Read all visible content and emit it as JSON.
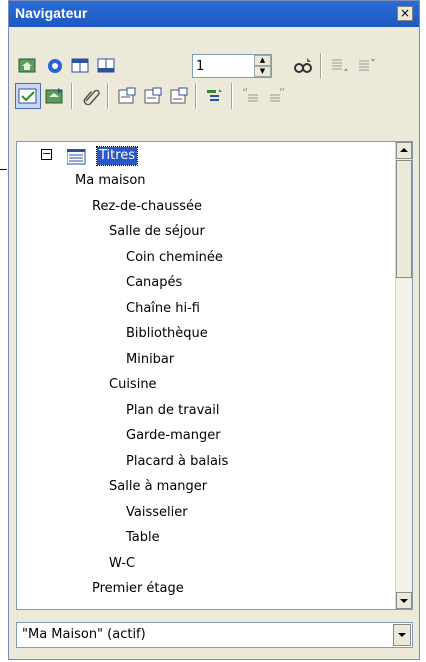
{
  "window": {
    "title": "Navigateur",
    "close_glyph": "×"
  },
  "toolbar": {
    "row1": [
      {
        "name": "navigation-toggle-icon"
      },
      {
        "name": "start-point-icon"
      },
      {
        "name": "header-icon"
      },
      {
        "name": "footer-icon"
      }
    ],
    "page_number": "1",
    "row1_right": [
      {
        "name": "drag-mode-icon"
      },
      {
        "name": "promote-level-icon"
      },
      {
        "name": "demote-level-icon"
      }
    ],
    "row2": [
      {
        "name": "content-view-icon"
      },
      {
        "name": "set-reminder-icon"
      },
      {
        "name": "edit-link-icon"
      },
      {
        "name": "anchor-note-icon"
      },
      {
        "name": "previous-object-icon"
      },
      {
        "name": "next-object-icon"
      },
      {
        "name": "heading-levels-icon"
      },
      {
        "name": "promote-chapter-icon"
      },
      {
        "name": "demote-chapter-icon"
      }
    ]
  },
  "tree": {
    "root": {
      "label": "Titres",
      "expander": "−"
    },
    "items": [
      {
        "label": "Ma maison",
        "level": 1
      },
      {
        "label": "Rez-de-chaussée",
        "level": 2
      },
      {
        "label": "Salle de séjour",
        "level": 3
      },
      {
        "label": "Coin cheminée",
        "level": 4
      },
      {
        "label": "Canapés",
        "level": 4
      },
      {
        "label": "Chaîne hi-fi",
        "level": 4
      },
      {
        "label": "Bibliothèque",
        "level": 4
      },
      {
        "label": "Minibar",
        "level": 4
      },
      {
        "label": "Cuisine",
        "level": 3
      },
      {
        "label": "Plan de travail",
        "level": 4
      },
      {
        "label": "Garde-manger",
        "level": 4
      },
      {
        "label": "Placard à balais",
        "level": 4
      },
      {
        "label": "Salle à manger",
        "level": 3
      },
      {
        "label": "Vaisselier",
        "level": 4
      },
      {
        "label": "Table",
        "level": 4
      },
      {
        "label": "W-C",
        "level": 3
      },
      {
        "label": "Premier étage",
        "level": 2
      }
    ]
  },
  "document_selector": {
    "value": "\"Ma Maison\" (actif)"
  },
  "colors": {
    "titlebar": "#1e58c0",
    "selection": "#2a57c4",
    "panel": "#ece9d8"
  }
}
